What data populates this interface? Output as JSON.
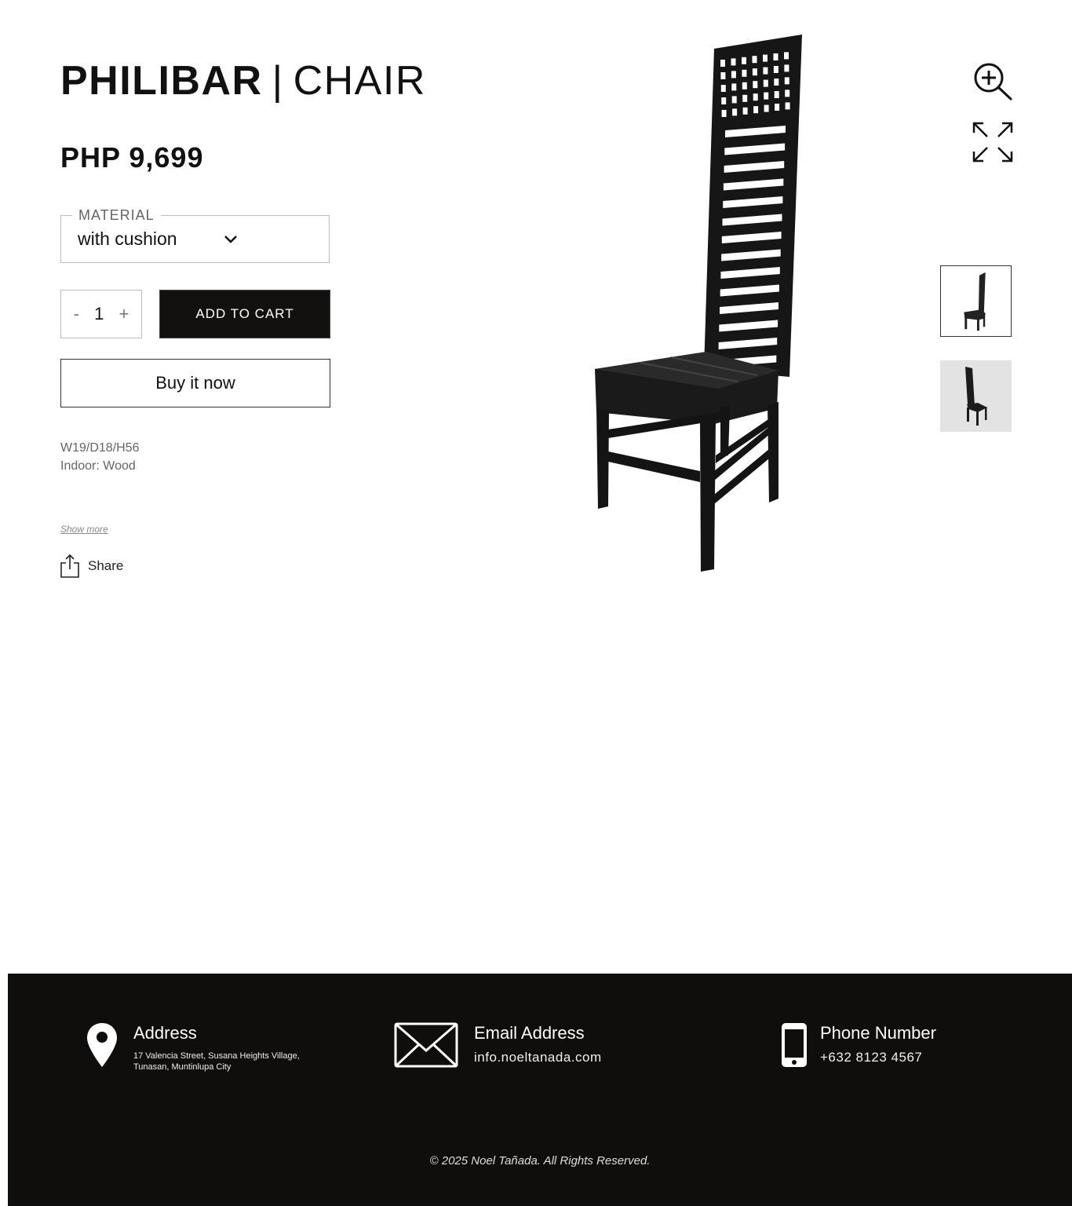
{
  "product": {
    "brand": "PHILIBAR",
    "separator": "|",
    "kind": "CHAIR",
    "price": "PHP 9,699",
    "material": {
      "label": "MATERIAL",
      "value": "with cushion"
    },
    "quantity": {
      "minus": "-",
      "value": "1",
      "plus": "+"
    },
    "add_to_cart": "ADD TO CART",
    "buy_now": "Buy it now",
    "specs": [
      "W19/D18/H56",
      "Indoor: Wood"
    ],
    "show_more": "Show more",
    "share": "Share"
  },
  "gallery": {
    "icons": [
      "zoom-in-icon",
      "expand-icon"
    ],
    "thumbnails": 2,
    "selected_thumbnail": 1
  },
  "footer": {
    "address": {
      "title": "Address",
      "line1": "17 Valencia Street, Susana Heights Village,",
      "line2": "Tunasan, Muntinlupa City"
    },
    "email": {
      "title": "Email Address",
      "value": "info.noeltanada.com"
    },
    "phone": {
      "title": "Phone Number",
      "value": "+632 8123 4567"
    },
    "copyright": "© 2025 Noel Tañada. All Rights Reserved."
  },
  "colors": {
    "dark": "#0f0e0d",
    "button": "#121110",
    "border": "#bdbdbd"
  }
}
